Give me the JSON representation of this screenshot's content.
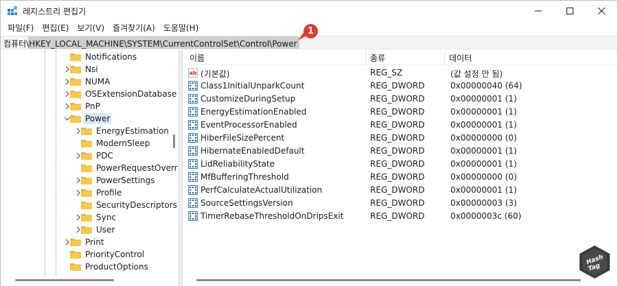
{
  "window": {
    "title": "레지스트리 편집기",
    "controls": {
      "minimize": "minimize",
      "maximize": "maximize",
      "close": "close"
    }
  },
  "menu": [
    "파일(F)",
    "편집(E)",
    "보기(V)",
    "즐겨찾기(A)",
    "도움말(H)"
  ],
  "address": {
    "path": "컴퓨터\\HKEY_LOCAL_MACHINE\\SYSTEM\\CurrentControlSet\\Control\\Power",
    "badge": "1"
  },
  "tree": [
    {
      "label": "Notifications",
      "level": 0,
      "expandable": false,
      "selected": false
    },
    {
      "label": "Nsi",
      "level": 0,
      "expandable": true,
      "selected": false
    },
    {
      "label": "NUMA",
      "level": 0,
      "expandable": true,
      "selected": false
    },
    {
      "label": "OSExtensionDatabase",
      "level": 0,
      "expandable": true,
      "selected": false
    },
    {
      "label": "PnP",
      "level": 0,
      "expandable": true,
      "selected": false
    },
    {
      "label": "Power",
      "level": 0,
      "expandable": true,
      "expanded": true,
      "selected": true
    },
    {
      "label": "EnergyEstimation",
      "level": 1,
      "expandable": true,
      "selected": false
    },
    {
      "label": "ModernSleep",
      "level": 1,
      "expandable": false,
      "selected": false
    },
    {
      "label": "PDC",
      "level": 1,
      "expandable": true,
      "selected": false
    },
    {
      "label": "PowerRequestOverr",
      "level": 1,
      "expandable": false,
      "selected": false
    },
    {
      "label": "PowerSettings",
      "level": 1,
      "expandable": true,
      "selected": false
    },
    {
      "label": "Profile",
      "level": 1,
      "expandable": true,
      "selected": false
    },
    {
      "label": "SecurityDescriptors",
      "level": 1,
      "expandable": false,
      "selected": false
    },
    {
      "label": "Sync",
      "level": 1,
      "expandable": true,
      "selected": false
    },
    {
      "label": "User",
      "level": 1,
      "expandable": true,
      "selected": false
    },
    {
      "label": "Print",
      "level": 0,
      "expandable": true,
      "selected": false
    },
    {
      "label": "PriorityControl",
      "level": 0,
      "expandable": false,
      "selected": false
    },
    {
      "label": "ProductOptions",
      "level": 0,
      "expandable": false,
      "selected": false
    }
  ],
  "list": {
    "columns": {
      "name": "이름",
      "type": "종류",
      "data": "데이터"
    },
    "rows": [
      {
        "icon": "string",
        "name": "(기본값)",
        "type": "REG_SZ",
        "data": "(값 설정 안 됨)"
      },
      {
        "icon": "binary",
        "name": "Class1InitialUnparkCount",
        "type": "REG_DWORD",
        "data": "0x00000040 (64)"
      },
      {
        "icon": "binary",
        "name": "CustomizeDuringSetup",
        "type": "REG_DWORD",
        "data": "0x00000001 (1)"
      },
      {
        "icon": "binary",
        "name": "EnergyEstimationEnabled",
        "type": "REG_DWORD",
        "data": "0x00000001 (1)"
      },
      {
        "icon": "binary",
        "name": "EventProcessorEnabled",
        "type": "REG_DWORD",
        "data": "0x00000001 (1)"
      },
      {
        "icon": "binary",
        "name": "HiberFileSizePercent",
        "type": "REG_DWORD",
        "data": "0x00000000 (0)"
      },
      {
        "icon": "binary",
        "name": "HibernateEnabledDefault",
        "type": "REG_DWORD",
        "data": "0x00000001 (1)"
      },
      {
        "icon": "binary",
        "name": "LidReliabilityState",
        "type": "REG_DWORD",
        "data": "0x00000001 (1)"
      },
      {
        "icon": "binary",
        "name": "MfBufferingThreshold",
        "type": "REG_DWORD",
        "data": "0x00000000 (0)"
      },
      {
        "icon": "binary",
        "name": "PerfCalculateActualUtilization",
        "type": "REG_DWORD",
        "data": "0x00000001 (1)"
      },
      {
        "icon": "binary",
        "name": "SourceSettingsVersion",
        "type": "REG_DWORD",
        "data": "0x00000003 (3)"
      },
      {
        "icon": "binary",
        "name": "TimerRebaseThresholdOnDripsExit",
        "type": "REG_DWORD",
        "data": "0x0000003c (60)"
      }
    ]
  },
  "watermark": {
    "line1": "Hash",
    "line2": "Tag"
  },
  "colors": {
    "selection": "#d6e8fb",
    "folder": "#f7c948",
    "badge": "#e23b2b",
    "accent": "#0a64c8"
  }
}
